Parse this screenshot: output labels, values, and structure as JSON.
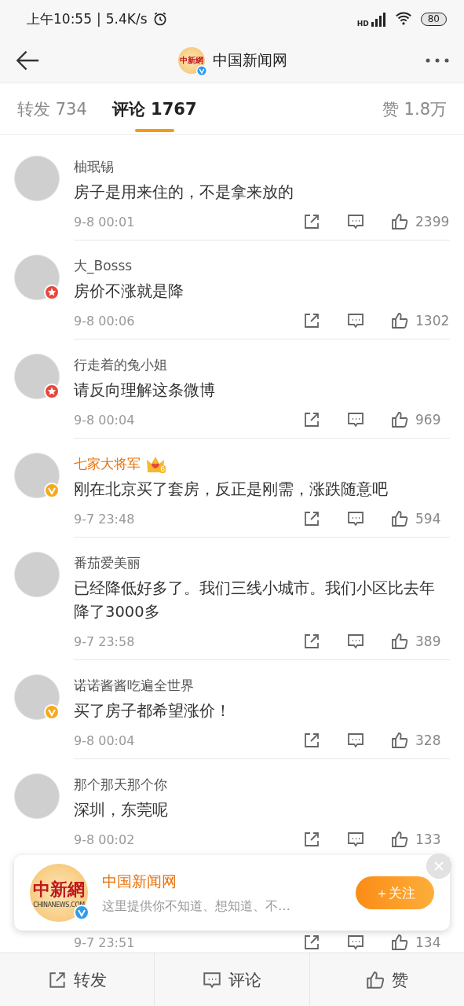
{
  "status_bar": {
    "time": "上午10:55",
    "separator": "|",
    "speed": "5.4K/s",
    "network": "HD",
    "battery": "80"
  },
  "header": {
    "title": "中国新闻网",
    "logo_text": "中新網",
    "verified": true
  },
  "tabs": [
    {
      "label": "转发 734",
      "selected": false
    },
    {
      "label": "评论 1767",
      "selected": true
    },
    {
      "label": "赞 1.8万",
      "selected": false
    }
  ],
  "comments": [
    {
      "name": "柚珉锡",
      "verified": false,
      "starred": false,
      "vip": false,
      "text": "房子是用来住的，不是拿来放的",
      "time": "9-8 00:01",
      "likes": "2399"
    },
    {
      "name": "大_Bosss",
      "verified": false,
      "starred": true,
      "vip": false,
      "text": "房价不涨就是降",
      "time": "9-8 00:06",
      "likes": "1302"
    },
    {
      "name": "行走着的兔小姐",
      "verified": false,
      "starred": true,
      "vip": false,
      "text": "请反向理解这条微博",
      "time": "9-8 00:04",
      "likes": "969"
    },
    {
      "name": "七家大将军",
      "verified": true,
      "starred": false,
      "vip": true,
      "vip_level": "6",
      "text": "刚在北京买了套房，反正是刚需，涨跌随意吧",
      "time": "9-7 23:48",
      "likes": "594"
    },
    {
      "name": "番茄爱美丽",
      "verified": false,
      "starred": false,
      "vip": false,
      "text": "已经降低好多了。我们三线小城市。我们小区比去年降了3000多",
      "time": "9-7 23:58",
      "likes": "389"
    },
    {
      "name": "诺诺酱酱吃遍全世界",
      "verified": true,
      "starred": false,
      "vip": false,
      "text": "买了房子都希望涨价！",
      "time": "9-8 00:04",
      "likes": "328"
    },
    {
      "name": "那个那天那个你",
      "verified": false,
      "starred": false,
      "vip": false,
      "text": "深圳，东莞呢",
      "time": "9-8 00:02",
      "likes": "133"
    },
    {
      "time": "9-7 23:51",
      "likes": "134"
    }
  ],
  "follow_card": {
    "name": "中国新闻网",
    "logo_text": "中新網",
    "logo_subtext": "CHINANEWS.COM",
    "description": "这里提供你不知道、想知道、不…",
    "button": "＋关注"
  },
  "bottom_bar": [
    {
      "kind": "repost",
      "label": "转发"
    },
    {
      "kind": "comment",
      "label": "评论"
    },
    {
      "kind": "like",
      "label": "赞"
    }
  ]
}
